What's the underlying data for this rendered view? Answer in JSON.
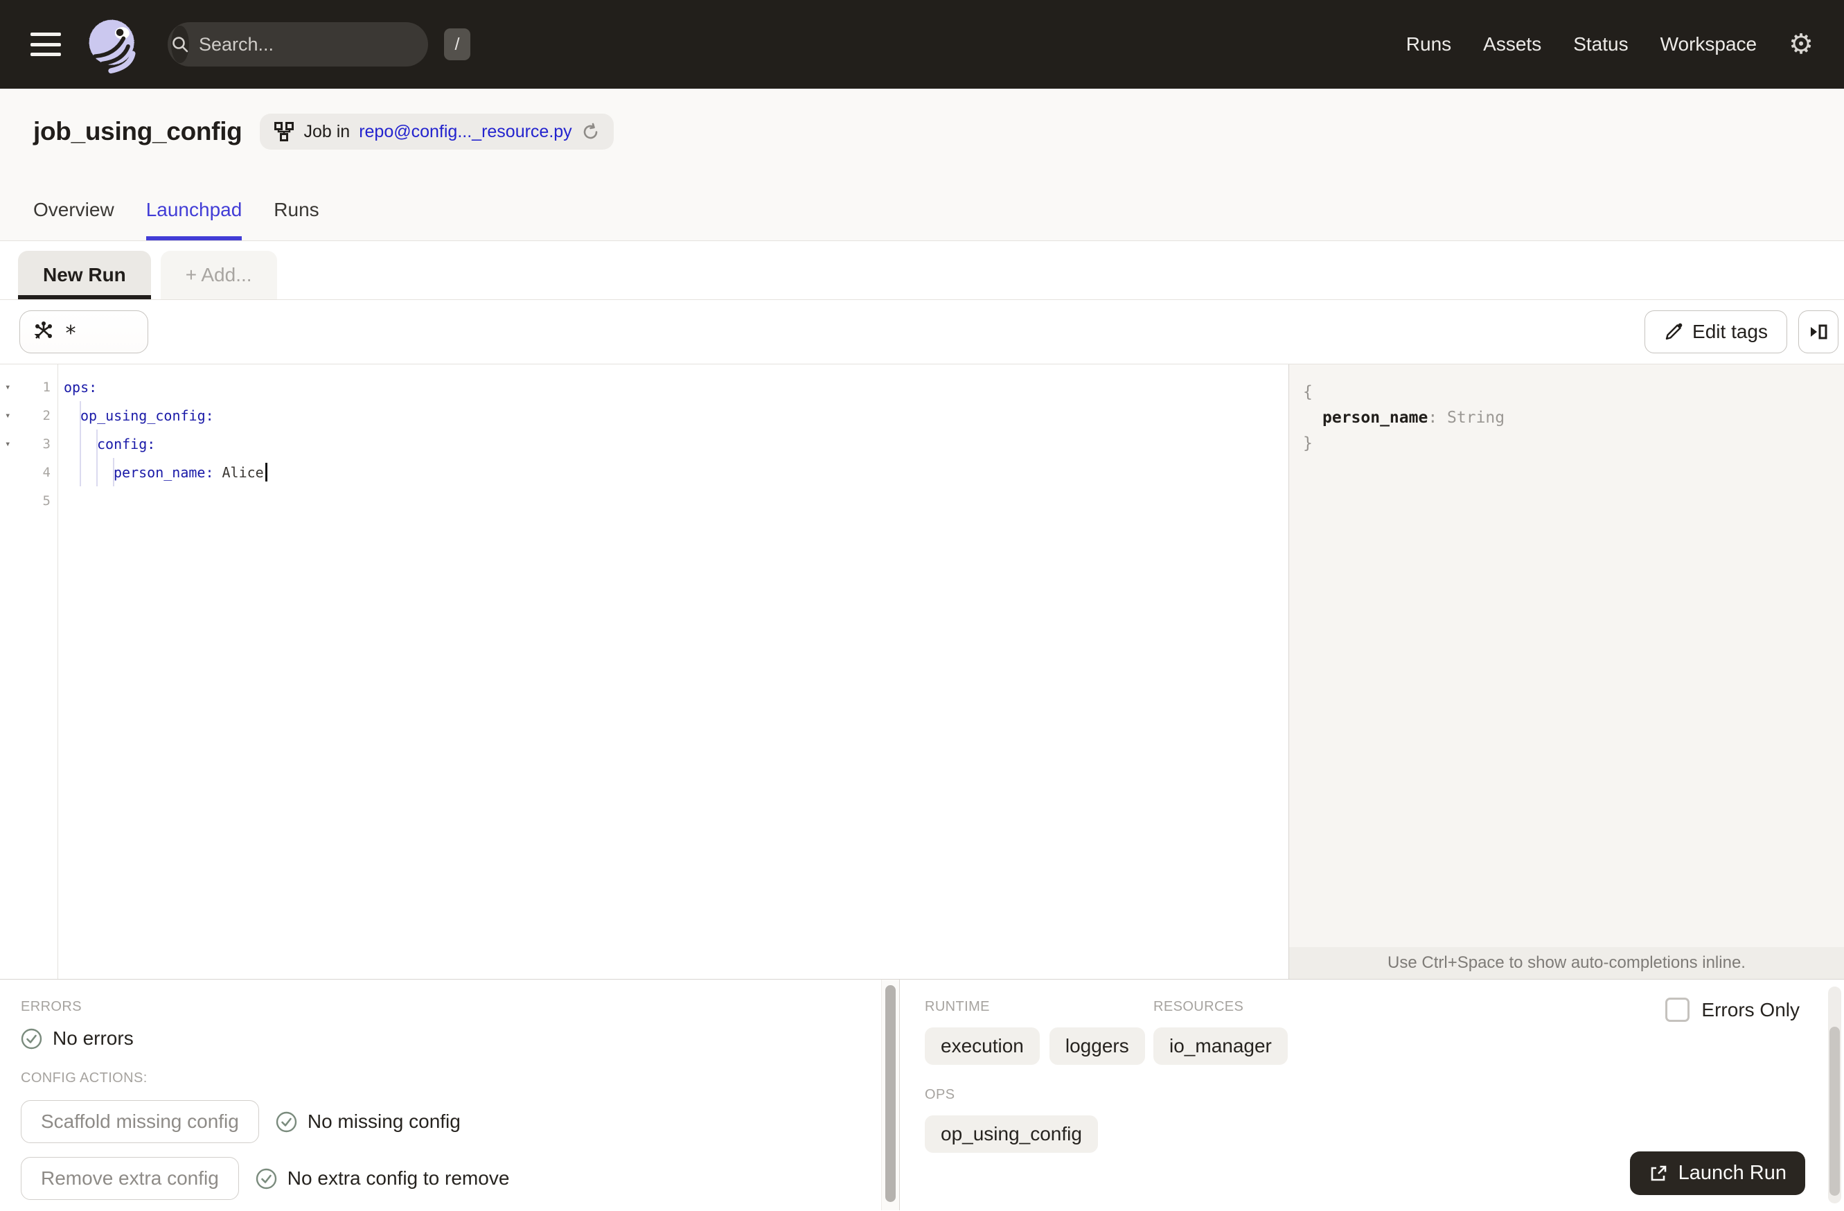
{
  "navbar": {
    "search_placeholder": "Search...",
    "search_value": "",
    "shortcut_key": "/",
    "links": [
      "Runs",
      "Assets",
      "Status",
      "Workspace"
    ],
    "gear_icon": "⚙"
  },
  "header": {
    "title": "job_using_config",
    "badge_prefix": "Job in",
    "badge_link": "repo@config..._resource.py"
  },
  "tabs": [
    {
      "label": "Overview"
    },
    {
      "label": "Launchpad"
    },
    {
      "label": "Runs"
    }
  ],
  "launchpad": {
    "session_tab": "New Run",
    "add_tab": "+ Add...",
    "op_selector_value": "*",
    "edit_tags_label": "Edit tags"
  },
  "editor": {
    "fold_icon": "▾",
    "lines": [
      {
        "num": "1",
        "key": "ops:",
        "value": ""
      },
      {
        "num": "2",
        "key": "op_using_config:",
        "value": ""
      },
      {
        "num": "3",
        "key": "config:",
        "value": ""
      },
      {
        "num": "4",
        "key": "person_name:",
        "value": "Alice"
      },
      {
        "num": "5",
        "key": "",
        "value": ""
      }
    ]
  },
  "schema": {
    "open_brace": "{",
    "field_name": "person_name",
    "separator": ":",
    "field_type": "String",
    "close_brace": "}",
    "hint": "Use Ctrl+Space to show auto-completions inline."
  },
  "bottom": {
    "errors_label": "ERRORS",
    "no_errors": "No errors",
    "config_actions_label": "CONFIG ACTIONS:",
    "actions": [
      {
        "button": "Scaffold missing config",
        "status": "No missing config"
      },
      {
        "button": "Remove extra config",
        "status": "No extra config to remove"
      }
    ],
    "runtime_label": "RUNTIME",
    "runtime_tags": [
      "execution",
      "loggers"
    ],
    "resources_label": "RESOURCES",
    "resources_tags": [
      "io_manager"
    ],
    "ops_label": "OPS",
    "ops_tags": [
      "op_using_config"
    ],
    "errors_only_label": "Errors Only",
    "launch_button": "Launch Run"
  },
  "colors": {
    "navbar_bg": "#221F1B",
    "accent_blurple": "#423DD6",
    "link_blue": "#2323CE",
    "editor_key_blue": "#1A1AA8",
    "logo_lavender": "#CBC8EF",
    "check_green": "#7A8B7D",
    "panel_bg": "#F7F5F2",
    "dark_button": "#2A2621"
  }
}
